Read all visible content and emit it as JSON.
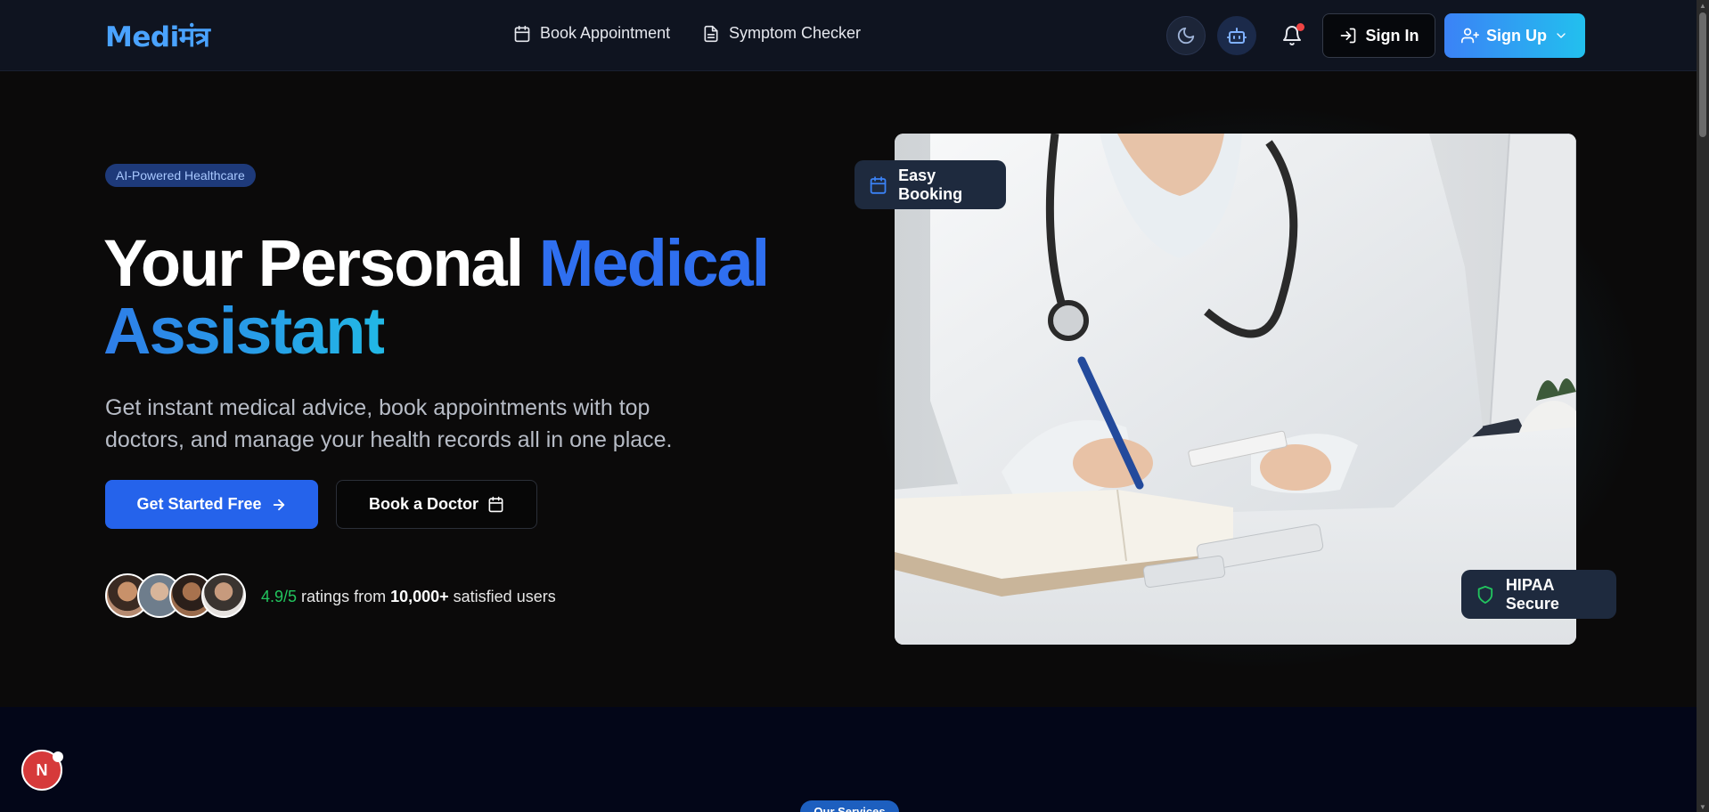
{
  "header": {
    "logo": "Mediमंत्र",
    "nav": [
      {
        "label": "Book Appointment",
        "icon": "calendar-icon"
      },
      {
        "label": "Symptom Checker",
        "icon": "document-icon"
      }
    ],
    "theme_toggle_icon": "moon-icon",
    "assistant_icon": "robot-icon",
    "notifications_icon": "bell-icon",
    "sign_in": "Sign In",
    "sign_up": "Sign Up"
  },
  "hero": {
    "badge": "AI-Powered Healthcare",
    "title_part1": "Your Personal ",
    "title_accent": "Medical",
    "title_part2": "Assistant",
    "subtitle": "Get instant medical advice, book appointments with top doctors, and manage your health records all in one place.",
    "cta_primary": "Get Started Free",
    "cta_secondary": "Book a Doctor",
    "rating_score": "4.9/5",
    "rating_text": " ratings from ",
    "rating_users": "10,000+",
    "rating_suffix": " satisfied users",
    "chip_booking": "Easy Booking",
    "chip_hipaa": "HIPAA Secure"
  },
  "section2": {
    "pill": "Our Services"
  },
  "fab": {
    "label": "N"
  },
  "colors": {
    "brand": "#4aa3ff",
    "primary": "#2563eb",
    "success": "#22c55e",
    "notification": "#ef4444"
  }
}
